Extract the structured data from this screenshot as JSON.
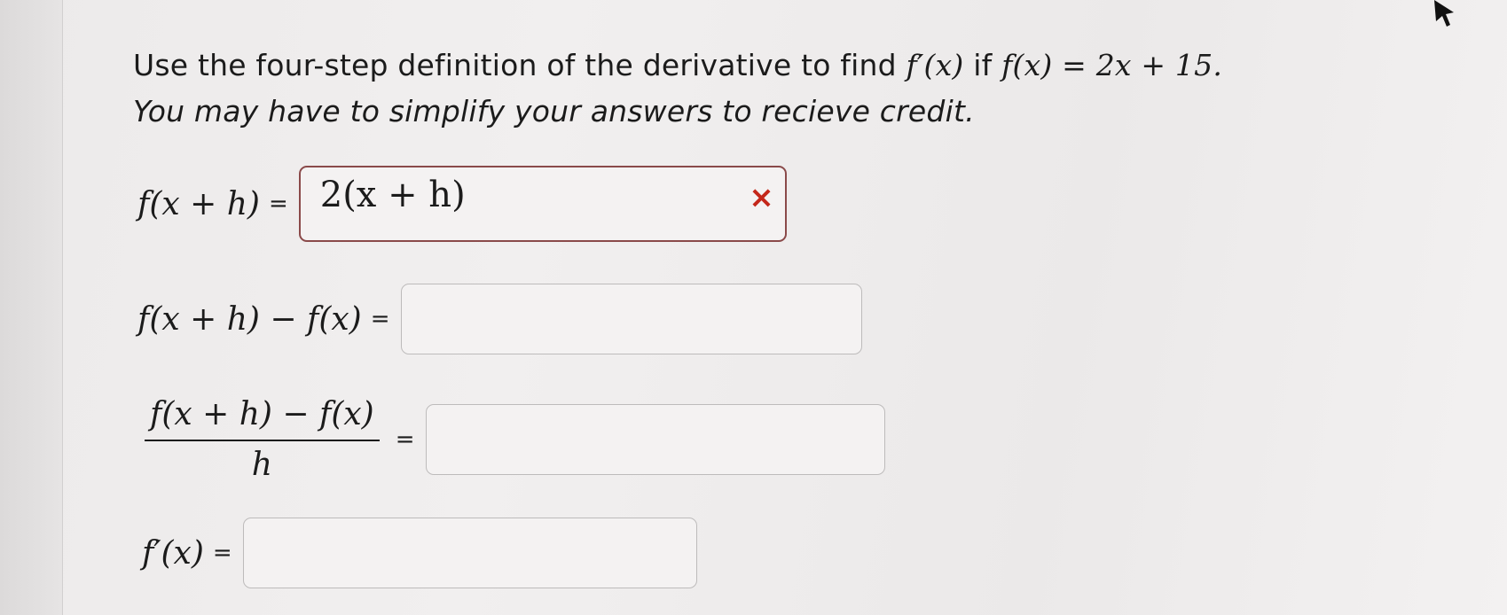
{
  "question": {
    "intro_text": "Use the four-step definition of the derivative to find ",
    "fprime_x": "f′(x)",
    "if_text": " if ",
    "function_def": "f(x) = 2x + 15.",
    "line2": "You may have to simplify your answers to recieve credit."
  },
  "steps": [
    {
      "lhs": "f(x + h)",
      "equals": "=",
      "value": "2(x + h)",
      "status_mark": "×"
    },
    {
      "lhs": "f(x + h) − f(x)",
      "equals": "=",
      "value": ""
    },
    {
      "numerator": "f(x + h) − f(x)",
      "denominator": "h",
      "equals": "=",
      "value": ""
    },
    {
      "lhs": "f′(x)",
      "equals": "=",
      "value": ""
    }
  ],
  "colors": {
    "wrong_mark": "#c4271a",
    "wrong_border": "#8a4a4a"
  },
  "icons": {
    "status": "x-mark-icon",
    "cursor": "mouse-pointer-icon"
  }
}
